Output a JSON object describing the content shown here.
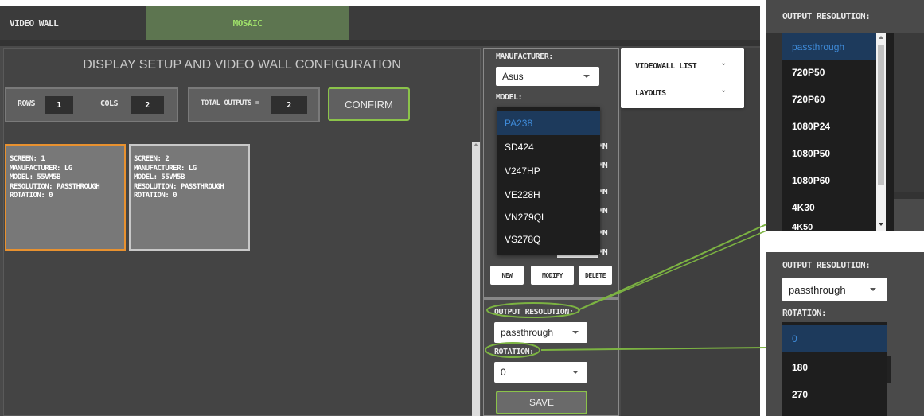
{
  "tabs": {
    "video_wall": "VIDEO WALL",
    "mosaic": "MOSAIC"
  },
  "left": {
    "title": "DISPLAY SETUP AND VIDEO WALL CONFIGURATION",
    "rows_label": "ROWS",
    "rows_value": "1",
    "cols_label": "COLS",
    "cols_value": "2",
    "total_label": "TOTAL OUTPUTS =",
    "total_value": "2",
    "confirm": "CONFIRM"
  },
  "screens": [
    {
      "screen": "SCREEN: 1",
      "manufacturer": "MANUFACTURER: LG",
      "model": "MODEL: 55VM5B",
      "resolution": "RESOLUTION: PASSTHROUGH",
      "rotation": "ROTATION: 0"
    },
    {
      "screen": "SCREEN: 2",
      "manufacturer": "MANUFACTURER: LG",
      "model": "MODEL: 55VM5B",
      "resolution": "RESOLUTION: PASSTHROUGH",
      "rotation": "ROTATION: 0"
    }
  ],
  "middle": {
    "manufacturer_label": "MANUFACTURER:",
    "manufacturer_value": "Asus",
    "model_label": "MODEL:",
    "model_options": [
      "PA238",
      "SD424",
      "V247HP",
      "VE228H",
      "VN279QL",
      "VS278Q"
    ],
    "mm": "MM",
    "new": "NEW",
    "modify": "MODIFY",
    "delete": "DELETE",
    "output_res_label": "OUTPUT RESOLUTION:",
    "output_res_value": "passthrough",
    "rotation_label": "ROTATION:",
    "rotation_value": "0",
    "save": "SAVE"
  },
  "right": {
    "videowall_list": "VIDEOWALL LIST",
    "layouts": "LAYOUTS"
  },
  "inset_resolution": {
    "label": "OUTPUT RESOLUTION:",
    "options": [
      "passthrough",
      "720P50",
      "720P60",
      "1080P24",
      "1080P50",
      "1080P60",
      "4K30",
      "4K50"
    ]
  },
  "inset_rotation": {
    "output_res_label": "OUTPUT RESOLUTION:",
    "output_res_value": "passthrough",
    "rotation_label": "ROTATION:",
    "options": [
      "0",
      "180",
      "270"
    ]
  },
  "colors": {
    "accent_green": "#8bc34a",
    "selected_orange": "#e8912f",
    "selected_blue": "#3f8bd9"
  }
}
